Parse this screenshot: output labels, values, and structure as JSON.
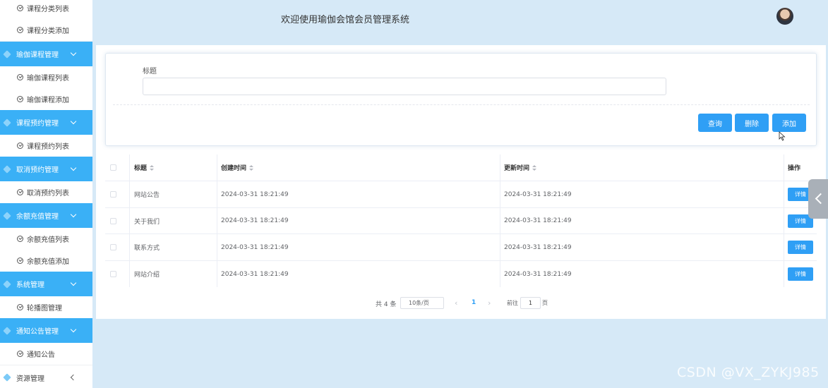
{
  "header": {
    "title": "欢迎使用瑜伽会馆会员管理系统"
  },
  "sidebar": {
    "items": [
      {
        "type": "sub",
        "label": "课程分类列表"
      },
      {
        "type": "sub",
        "label": "课程分类添加"
      },
      {
        "type": "head",
        "label": "瑜伽课程管理"
      },
      {
        "type": "sub",
        "label": "瑜伽课程列表"
      },
      {
        "type": "sub",
        "label": "瑜伽课程添加"
      },
      {
        "type": "head",
        "label": "课程预约管理"
      },
      {
        "type": "sub",
        "label": "课程预约列表"
      },
      {
        "type": "head",
        "label": "取消预约管理"
      },
      {
        "type": "sub",
        "label": "取消预约列表"
      },
      {
        "type": "head",
        "label": "余额充值管理"
      },
      {
        "type": "sub",
        "label": "余额充值列表"
      },
      {
        "type": "sub",
        "label": "余额充值添加"
      },
      {
        "type": "head",
        "label": "系统管理"
      },
      {
        "type": "sub",
        "label": "轮播图管理"
      },
      {
        "type": "head",
        "label": "通知公告管理"
      },
      {
        "type": "sub",
        "label": "通知公告"
      },
      {
        "type": "last",
        "label": "资源管理"
      }
    ]
  },
  "search": {
    "label": "标题",
    "value": "",
    "placeholder": ""
  },
  "buttons": {
    "query": "查询",
    "delete": "删除",
    "add": "添加"
  },
  "table": {
    "headers": {
      "title": "标题",
      "created": "创建时间",
      "updated": "更新时间",
      "action": "操作"
    },
    "rows": [
      {
        "title": "网站公告",
        "created": "2024-03-31 18:21:49",
        "updated": "2024-03-31 18:21:49",
        "action": "详情"
      },
      {
        "title": "关于我们",
        "created": "2024-03-31 18:21:49",
        "updated": "2024-03-31 18:21:49",
        "action": "详情"
      },
      {
        "title": "联系方式",
        "created": "2024-03-31 18:21:49",
        "updated": "2024-03-31 18:21:49",
        "action": "详情"
      },
      {
        "title": "网站介绍",
        "created": "2024-03-31 18:21:49",
        "updated": "2024-03-31 18:21:49",
        "action": "详情"
      }
    ]
  },
  "pagination": {
    "total": "共 4 条",
    "page_size": "10条/页",
    "prev": "‹",
    "current": "1",
    "next": "›",
    "goto_label": "前往",
    "goto_value": "1",
    "page_unit": "页"
  },
  "watermark": "CSDN @VX_ZYKJ985",
  "colors": {
    "accent": "#2f9ff5",
    "sidebar_head": "#3ab0f6",
    "background": "#d6e9f7"
  }
}
